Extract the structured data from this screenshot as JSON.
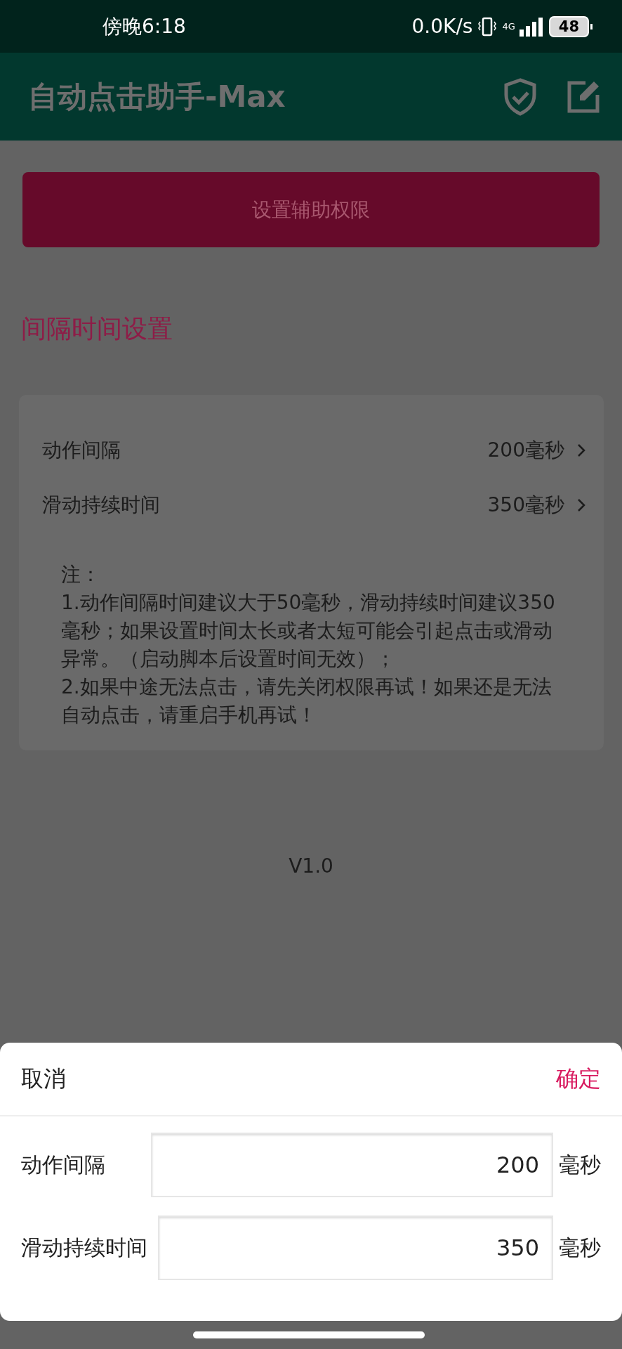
{
  "status_bar": {
    "time": "傍晚6:18",
    "net_speed": "0.0K/s",
    "network": "4G",
    "battery": "48"
  },
  "app_bar": {
    "title": "自动点击助手-Max"
  },
  "permission_button": {
    "label": "设置辅助权限"
  },
  "section_title": "间隔时间设置",
  "settings": [
    {
      "label": "动作间隔",
      "value": "200毫秒"
    },
    {
      "label": "滑动持续时间",
      "value": "350毫秒"
    }
  ],
  "note": {
    "heading": "注：",
    "lines": [
      "1.动作间隔时间建议大于50毫秒，滑动持续时间建议350毫秒；如果设置时间太长或者太短可能会引起点击或滑动异常。（启动脚本后设置时间无效）；",
      "2.如果中途无法点击，请先关闭权限再试！如果还是无法自动点击，请重启手机再试！"
    ]
  },
  "version": "V1.0",
  "sheet": {
    "cancel": "取消",
    "confirm": "确定",
    "fields": [
      {
        "label": "动作间隔",
        "value": "200",
        "unit": "毫秒"
      },
      {
        "label": "滑动持续时间",
        "value": "350",
        "unit": "毫秒"
      }
    ]
  }
}
